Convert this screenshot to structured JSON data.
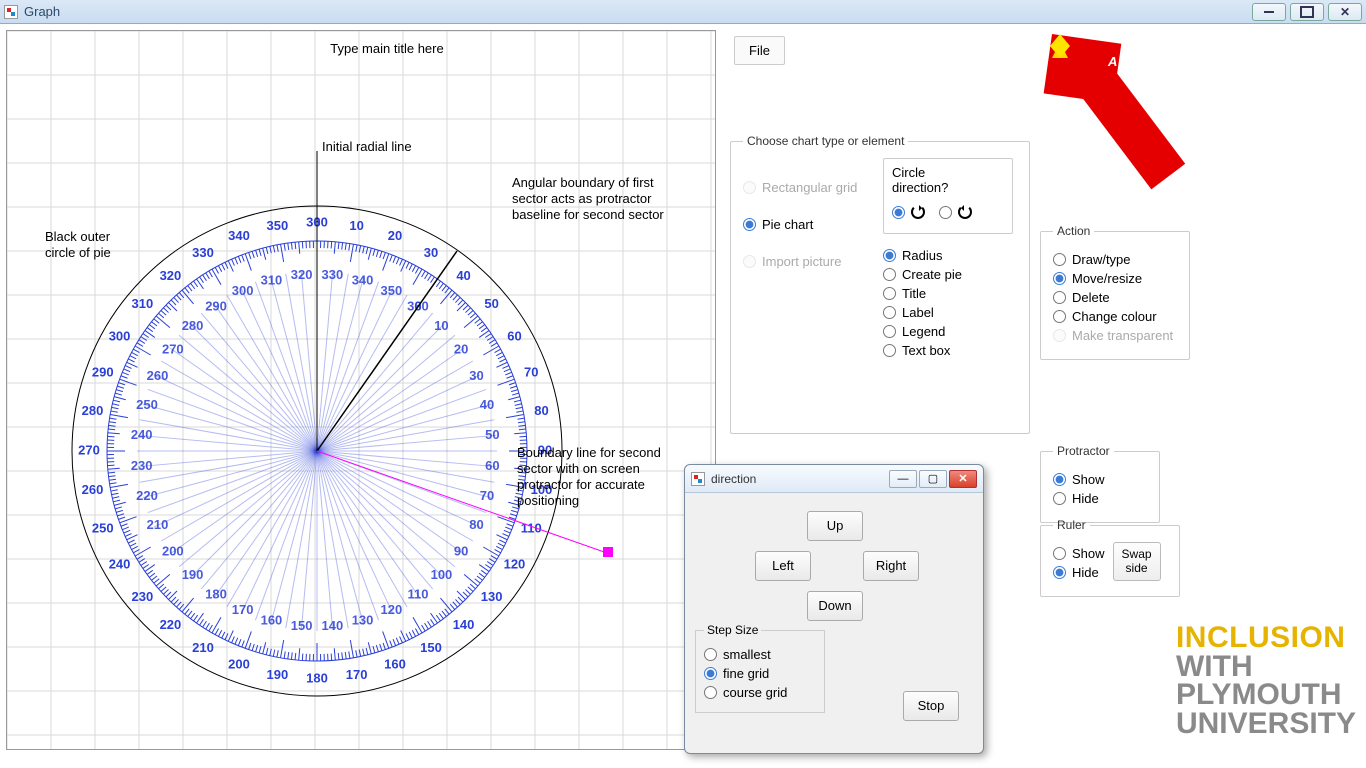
{
  "window": {
    "title": "Graph"
  },
  "chart": {
    "title_placeholder": "Type main title here",
    "labels": {
      "outer_circle": "Black outer\ncircle of pie",
      "initial_radial": "Initial radial line",
      "angular_boundary": "Angular boundary of first\nsector acts as protractor\nbaseline for second sector",
      "boundary_line": "Boundary line for second\nsector with on screen\nprotractor for accurate\npositioning"
    }
  },
  "menu": {
    "file": "File"
  },
  "choose": {
    "legend": "Choose chart type or element",
    "rect_grid": "Rectangular grid",
    "pie_chart": "Pie chart",
    "import_picture": "Import picture",
    "circle_direction": "Circle\ndirection?",
    "radius": "Radius",
    "create_pie": "Create pie",
    "title_opt": "Title",
    "label_opt": "Label",
    "legend_opt": "Legend",
    "textbox_opt": "Text box"
  },
  "action": {
    "legend": "Action",
    "draw_type": "Draw/type",
    "move_resize": "Move/resize",
    "delete": "Delete",
    "change_colour": "Change colour",
    "make_transparent": "Make transparent"
  },
  "protractor": {
    "legend": "Protractor",
    "show": "Show",
    "hide": "Hide"
  },
  "ruler": {
    "legend": "Ruler",
    "show": "Show",
    "hide": "Hide",
    "swap": "Swap\nside"
  },
  "dialog": {
    "title": "direction",
    "up": "Up",
    "down": "Down",
    "left": "Left",
    "right": "Right",
    "stop": "Stop",
    "step_legend": "Step Size",
    "smallest": "smallest",
    "fine": "fine grid",
    "course": "course grid"
  },
  "brand": {
    "l1": "INCLUSION",
    "l2": "WITH",
    "l3": "PLYMOUTH",
    "l4": "UNIVERSITY"
  },
  "chart_data": {
    "type": "pie",
    "title": "Type main title here",
    "protractor": {
      "center": [
        310,
        420
      ],
      "radius": 245,
      "outer_scale_deg": {
        "start": 0,
        "end": 360,
        "step": 10
      },
      "inner_scale_deg": {
        "start": 0,
        "end": 360,
        "step": 10
      }
    },
    "radial_lines": [
      {
        "name": "initial_radial",
        "angle_deg_from_vertical": 0
      },
      {
        "name": "first_sector_boundary",
        "angle_deg_from_vertical": 35
      },
      {
        "name": "second_sector_boundary_dragging",
        "angle_deg_from_vertical": 110,
        "color": "magenta",
        "handle": true
      }
    ]
  }
}
